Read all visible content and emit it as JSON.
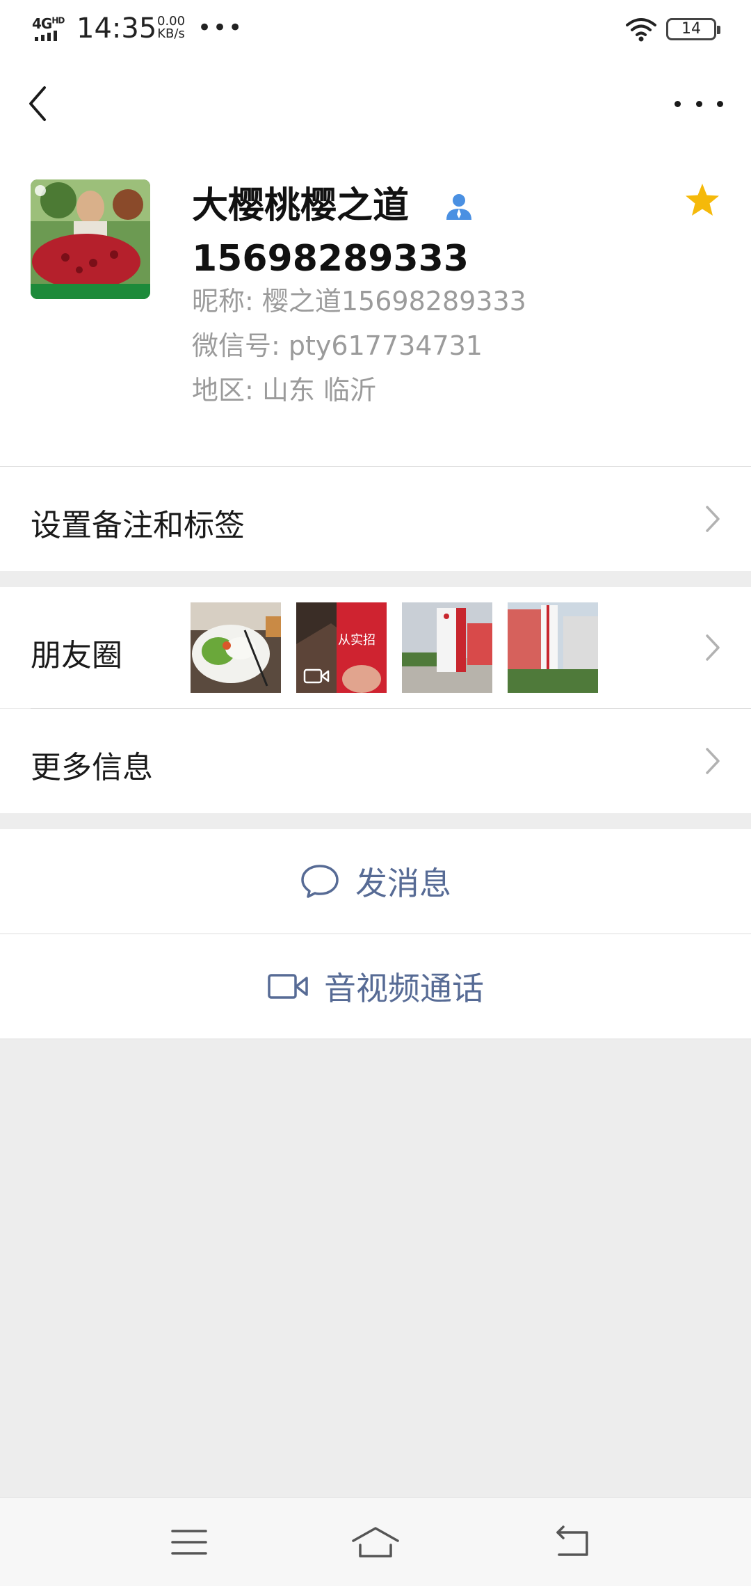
{
  "status_bar": {
    "network": "4G",
    "network_sup": "HD",
    "time": "14:35",
    "speed_value": "0.00",
    "speed_unit": "KB/s",
    "overflow": "•••",
    "battery": "14"
  },
  "profile": {
    "display_name_line1": "大樱桃樱之道",
    "display_name_line2": "15698289333",
    "nickname": "昵称:  樱之道15698289333",
    "wechat_id": "微信号:  pty617734731",
    "region": "地区:  山东  临沂",
    "starred": true
  },
  "rows": {
    "remark_tags": "设置备注和标签",
    "moments": "朋友圈",
    "more_info": "更多信息"
  },
  "moment_thumbnails": [
    {
      "name": "food-plate-photo",
      "video": false
    },
    {
      "name": "red-banner-video",
      "video": true,
      "text": "从实招"
    },
    {
      "name": "signboard-photo",
      "video": false
    },
    {
      "name": "building-photo",
      "video": false
    }
  ],
  "actions": {
    "send_message": "发消息",
    "video_call": "音视频通话"
  },
  "colors": {
    "link_blue": "#576b95",
    "star_yellow": "#f5b90a",
    "contact_icon_blue": "#4a90e2",
    "secondary_text": "#9b9b9b"
  },
  "icons": {
    "back": "back-arrow-icon",
    "more": "more-dots-icon",
    "contact": "contact-person-icon",
    "star": "star-icon",
    "chat": "chat-bubble-icon",
    "video": "video-camera-icon",
    "menu": "menu-icon",
    "home": "home-icon",
    "return": "return-icon"
  }
}
